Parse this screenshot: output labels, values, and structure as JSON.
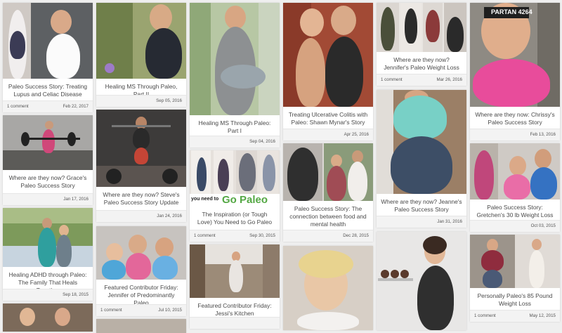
{
  "posts": [
    {
      "title": "Paleo Success Story: Treating Lupus and Celiac Disease",
      "comments": "1 comment",
      "date": "Feb 22, 2017"
    },
    {
      "title": "Where are they now? Grace's Paleo Success Story",
      "comments": "",
      "date": "Jan 17, 2016"
    },
    {
      "title": "Healing ADHD through Paleo: The Family That Heals Together",
      "comments": "",
      "date": "Sep 18, 2015"
    },
    {
      "title": "Healing MS Through Paleo, Part II",
      "comments": "",
      "date": "Sep 05, 2016"
    },
    {
      "title": "Where are they now? Steve's Paleo Success Story Update",
      "comments": "",
      "date": "Jan 24, 2016"
    },
    {
      "title": "Featured Contributor Friday: Jennifer of Predominantly Paleo",
      "comments": "1 comment",
      "date": "Jul 10, 2015"
    },
    {
      "title": "Healing MS Through Paleo: Part I",
      "comments": "",
      "date": "Sep 04, 2016"
    },
    {
      "title": "The Inspiration (or Tough Love) You Need to Go Paleo",
      "comments": "1 comment",
      "date": "Sep 30, 2015"
    },
    {
      "title": "Featured Contributor Friday: Jessi's Kitchen",
      "comments": "",
      "date": ""
    },
    {
      "title": "Treating Ulcerative Colitis with Paleo: Shawn Mynar's Story",
      "comments": "",
      "date": "Apr 25, 2016"
    },
    {
      "title": "Paleo Success Story: The connection between food and mental health",
      "comments": "",
      "date": "Dec 28, 2015"
    },
    {
      "title": "Where are they now? Jennifer's Paleo Weight Loss",
      "comments": "1 comment",
      "date": "Mar 26, 2016"
    },
    {
      "title": "Where are they now? Jeanne's Paleo Success Story",
      "comments": "",
      "date": "Jan 31, 2016"
    },
    {
      "title": "Where are they now: Chrissy's Paleo Success Story",
      "comments": "",
      "date": "Feb 13, 2016"
    },
    {
      "title": "Paleo Success Story: Gretchen's 30 lb Weight Loss",
      "comments": "",
      "date": "Oct 03, 2015"
    },
    {
      "title": "Personally Paleo's 85 Pound Weight Loss",
      "comments": "1 comment",
      "date": "May 12, 2015"
    }
  ],
  "image_text": {
    "go_paleo": "Go Paleo",
    "you_need_to": "you need to",
    "bib": "PARTAN 4264"
  }
}
